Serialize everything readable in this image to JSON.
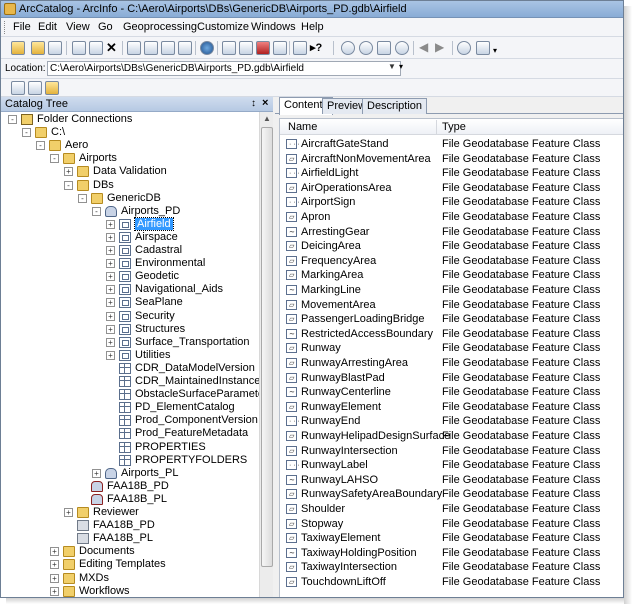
{
  "window": {
    "title": "ArcCatalog - ArcInfo - C:\\Aero\\Airports\\DBs\\GenericDB\\Airports_PD.gdb\\Airfield"
  },
  "menu": [
    "File",
    "Edit",
    "View",
    "Go",
    "Geoprocessing",
    "Customize",
    "Windows",
    "Help"
  ],
  "location": {
    "label": "Location:",
    "value": "C:\\Aero\\Airports\\DBs\\GenericDB\\Airports_PD.gdb\\Airfield"
  },
  "catalog": {
    "title": "Catalog Tree",
    "pin_glyph": "↕",
    "close_glyph": "×",
    "nodes": [
      {
        "label": "Folder Connections",
        "indent": 0,
        "icon": "connection",
        "expander": "-"
      },
      {
        "label": "C:\\",
        "indent": 1,
        "icon": "folder",
        "expander": "-"
      },
      {
        "label": "Aero",
        "indent": 2,
        "icon": "folder",
        "expander": "-"
      },
      {
        "label": "Airports",
        "indent": 3,
        "icon": "folder",
        "expander": "-"
      },
      {
        "label": "Data Validation",
        "indent": 4,
        "icon": "folder",
        "expander": "+"
      },
      {
        "label": "DBs",
        "indent": 4,
        "icon": "folder",
        "expander": "-"
      },
      {
        "label": "GenericDB",
        "indent": 5,
        "icon": "folder",
        "expander": "-"
      },
      {
        "label": "Airports_PD",
        "indent": 6,
        "icon": "geodatabase",
        "expander": "-"
      },
      {
        "label": "Airfield",
        "indent": 7,
        "icon": "feature-dataset",
        "expander": "+",
        "selected": true
      },
      {
        "label": "Airspace",
        "indent": 7,
        "icon": "feature-dataset",
        "expander": "+"
      },
      {
        "label": "Cadastral",
        "indent": 7,
        "icon": "feature-dataset",
        "expander": "+"
      },
      {
        "label": "Environmental",
        "indent": 7,
        "icon": "feature-dataset",
        "expander": "+"
      },
      {
        "label": "Geodetic",
        "indent": 7,
        "icon": "feature-dataset",
        "expander": "+"
      },
      {
        "label": "Navigational_Aids",
        "indent": 7,
        "icon": "feature-dataset",
        "expander": "+"
      },
      {
        "label": "SeaPlane",
        "indent": 7,
        "icon": "feature-dataset",
        "expander": "+"
      },
      {
        "label": "Security",
        "indent": 7,
        "icon": "feature-dataset",
        "expander": "+"
      },
      {
        "label": "Structures",
        "indent": 7,
        "icon": "feature-dataset",
        "expander": "+"
      },
      {
        "label": "Surface_Transportation",
        "indent": 7,
        "icon": "feature-dataset",
        "expander": "+"
      },
      {
        "label": "Utilities",
        "indent": 7,
        "icon": "feature-dataset",
        "expander": "+"
      },
      {
        "label": "CDR_DataModelVersion",
        "indent": 7,
        "icon": "table",
        "expander": ""
      },
      {
        "label": "CDR_MaintainedInstance",
        "indent": 7,
        "icon": "table",
        "expander": ""
      },
      {
        "label": "ObstacleSurfaceParameter",
        "indent": 7,
        "icon": "table",
        "expander": ""
      },
      {
        "label": "PD_ElementCatalog",
        "indent": 7,
        "icon": "table",
        "expander": ""
      },
      {
        "label": "Prod_ComponentVersion",
        "indent": 7,
        "icon": "table",
        "expander": ""
      },
      {
        "label": "Prod_FeatureMetadata",
        "indent": 7,
        "icon": "table",
        "expander": ""
      },
      {
        "label": "PROPERTIES",
        "indent": 7,
        "icon": "table",
        "expander": ""
      },
      {
        "label": "PROPERTYFOLDERS",
        "indent": 7,
        "icon": "table",
        "expander": ""
      },
      {
        "label": "Airports_PL",
        "indent": 6,
        "icon": "geodatabase",
        "expander": "+"
      },
      {
        "label": "FAA18B_PD",
        "indent": 5,
        "icon": "sde",
        "expander": ""
      },
      {
        "label": "FAA18B_PL",
        "indent": 5,
        "icon": "sde",
        "expander": ""
      },
      {
        "label": "Reviewer",
        "indent": 4,
        "icon": "folder",
        "expander": "+"
      },
      {
        "label": "FAA18B_PD",
        "indent": 4,
        "icon": "server",
        "expander": ""
      },
      {
        "label": "FAA18B_PL",
        "indent": 4,
        "icon": "server",
        "expander": ""
      },
      {
        "label": "Documents",
        "indent": 3,
        "icon": "folder",
        "expander": "+"
      },
      {
        "label": "Editing Templates",
        "indent": 3,
        "icon": "folder",
        "expander": "+"
      },
      {
        "label": "MXDs",
        "indent": 3,
        "icon": "folder",
        "expander": "+"
      },
      {
        "label": "Workflows",
        "indent": 3,
        "icon": "folder",
        "expander": "+"
      }
    ]
  },
  "tabs": [
    "Contents",
    "Preview",
    "Description"
  ],
  "contents": {
    "columns": [
      "Name",
      "Type"
    ],
    "rows": [
      {
        "name": "AircraftGateStand",
        "type": "File Geodatabase Feature Class",
        "geom": "point"
      },
      {
        "name": "AircraftNonMovementArea",
        "type": "File Geodatabase Feature Class",
        "geom": "polygon"
      },
      {
        "name": "AirfieldLight",
        "type": "File Geodatabase Feature Class",
        "geom": "point"
      },
      {
        "name": "AirOperationsArea",
        "type": "File Geodatabase Feature Class",
        "geom": "polygon"
      },
      {
        "name": "AirportSign",
        "type": "File Geodatabase Feature Class",
        "geom": "point"
      },
      {
        "name": "Apron",
        "type": "File Geodatabase Feature Class",
        "geom": "polygon"
      },
      {
        "name": "ArrestingGear",
        "type": "File Geodatabase Feature Class",
        "geom": "line"
      },
      {
        "name": "DeicingArea",
        "type": "File Geodatabase Feature Class",
        "geom": "polygon"
      },
      {
        "name": "FrequencyArea",
        "type": "File Geodatabase Feature Class",
        "geom": "polygon"
      },
      {
        "name": "MarkingArea",
        "type": "File Geodatabase Feature Class",
        "geom": "polygon"
      },
      {
        "name": "MarkingLine",
        "type": "File Geodatabase Feature Class",
        "geom": "line"
      },
      {
        "name": "MovementArea",
        "type": "File Geodatabase Feature Class",
        "geom": "polygon"
      },
      {
        "name": "PassengerLoadingBridge",
        "type": "File Geodatabase Feature Class",
        "geom": "polygon"
      },
      {
        "name": "RestrictedAccessBoundary",
        "type": "File Geodatabase Feature Class",
        "geom": "line"
      },
      {
        "name": "Runway",
        "type": "File Geodatabase Feature Class",
        "geom": "polygon"
      },
      {
        "name": "RunwayArrestingArea",
        "type": "File Geodatabase Feature Class",
        "geom": "polygon"
      },
      {
        "name": "RunwayBlastPad",
        "type": "File Geodatabase Feature Class",
        "geom": "polygon"
      },
      {
        "name": "RunwayCenterline",
        "type": "File Geodatabase Feature Class",
        "geom": "line"
      },
      {
        "name": "RunwayElement",
        "type": "File Geodatabase Feature Class",
        "geom": "polygon"
      },
      {
        "name": "RunwayEnd",
        "type": "File Geodatabase Feature Class",
        "geom": "point"
      },
      {
        "name": "RunwayHelipadDesignSurface",
        "type": "File Geodatabase Feature Class",
        "geom": "polygon"
      },
      {
        "name": "RunwayIntersection",
        "type": "File Geodatabase Feature Class",
        "geom": "polygon"
      },
      {
        "name": "RunwayLabel",
        "type": "File Geodatabase Feature Class",
        "geom": "point"
      },
      {
        "name": "RunwayLAHSO",
        "type": "File Geodatabase Feature Class",
        "geom": "line"
      },
      {
        "name": "RunwaySafetyAreaBoundary",
        "type": "File Geodatabase Feature Class",
        "geom": "polygon"
      },
      {
        "name": "Shoulder",
        "type": "File Geodatabase Feature Class",
        "geom": "polygon"
      },
      {
        "name": "Stopway",
        "type": "File Geodatabase Feature Class",
        "geom": "polygon"
      },
      {
        "name": "TaxiwayElement",
        "type": "File Geodatabase Feature Class",
        "geom": "polygon"
      },
      {
        "name": "TaxiwayHoldingPosition",
        "type": "File Geodatabase Feature Class",
        "geom": "line"
      },
      {
        "name": "TaxiwayIntersection",
        "type": "File Geodatabase Feature Class",
        "geom": "polygon"
      },
      {
        "name": "TouchdownLiftOff",
        "type": "File Geodatabase Feature Class",
        "geom": "polygon"
      }
    ]
  },
  "colors": {
    "selection": "#3399ff",
    "title_bar": "#a9c4e4",
    "folder": "#f1cf6a"
  }
}
